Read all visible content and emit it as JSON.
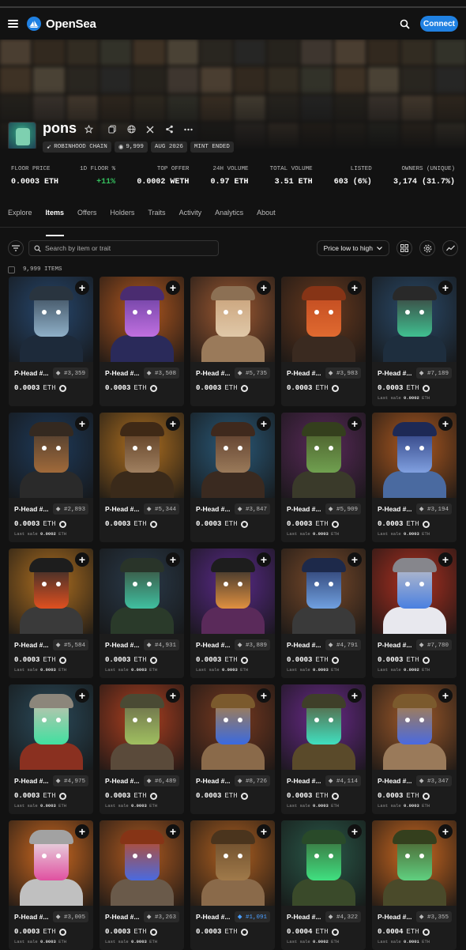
{
  "header": {
    "brand": "OpenSea",
    "connect_label": "Connect"
  },
  "collection": {
    "name": "pons",
    "chips": [
      {
        "icon": "robinhood-icon",
        "label": "ROBINHOOD CHAIN"
      },
      {
        "icon": "items-icon",
        "label": "9,999"
      },
      {
        "icon": "",
        "label": "AUG 2026"
      },
      {
        "icon": "",
        "label": "MINT ENDED"
      }
    ]
  },
  "stats": [
    {
      "label": "FLOOR PRICE",
      "value": "0.0003 ETH"
    },
    {
      "label": "1D FLOOR %",
      "value": "+11%"
    },
    {
      "label": "TOP OFFER",
      "value": "0.0002 WETH"
    },
    {
      "label": "24H VOLUME",
      "value": "0.97 ETH"
    },
    {
      "label": "TOTAL VOLUME",
      "value": "3.51 ETH"
    },
    {
      "label": "LISTED",
      "value": "603 (6%)"
    },
    {
      "label": "OWNERS (UNIQUE)",
      "value": "3,174 (31.7%)"
    }
  ],
  "tabs": [
    "Explore",
    "Items",
    "Offers",
    "Holders",
    "Traits",
    "Activity",
    "Analytics",
    "About"
  ],
  "active_tab": "Items",
  "toolbar": {
    "search_placeholder": "Search by item or trait",
    "sort_label": "Price low to high"
  },
  "item_count": "9,999 ITEMS",
  "items": [
    {
      "name": "P-Head #...",
      "rank": "#3,359",
      "price": "0.0003",
      "unit": "ETH",
      "last_sale": "",
      "palette": [
        "#26476e",
        "#3a4a5a",
        "#1d2a3a",
        "#8fb0c8"
      ]
    },
    {
      "name": "P-Head #...",
      "rank": "#3,508",
      "price": "0.0003",
      "unit": "ETH",
      "last_sale": "",
      "palette": [
        "#b4581f",
        "#6a3fa0",
        "#2a2a5a",
        "#c070e0"
      ]
    },
    {
      "name": "P-Head #...",
      "rank": "#5,735",
      "price": "0.0003",
      "unit": "ETH",
      "last_sale": "",
      "palette": [
        "#a05a32",
        "#c8a078",
        "#9a7a5a",
        "#e0c8a8"
      ]
    },
    {
      "name": "P-Head #...",
      "rank": "#3,983",
      "price": "0.0003",
      "unit": "ETH",
      "last_sale": "",
      "palette": [
        "#6a3a1e",
        "#c04a20",
        "#3a2a20",
        "#e06a30"
      ]
    },
    {
      "name": "P-Head #...",
      "rank": "#7,189",
      "price": "0.0003",
      "unit": "ETH",
      "last_sale": "0.0002",
      "palette": [
        "#2a4a6a",
        "#3a3a3a",
        "#1e2e3e",
        "#40c090"
      ]
    },
    {
      "name": "P-Head #...",
      "rank": "#2,893",
      "price": "0.0003",
      "unit": "ETH",
      "last_sale": "0.0002",
      "palette": [
        "#1e3a5a",
        "#4a3a2e",
        "#2a2a2a",
        "#a06a3a"
      ]
    },
    {
      "name": "P-Head #...",
      "rank": "#5,344",
      "price": "0.0003",
      "unit": "ETH",
      "last_sale": "",
      "palette": [
        "#b07020",
        "#5a3a20",
        "#3a2a1a",
        "#a08060"
      ]
    },
    {
      "name": "P-Head #...",
      "rank": "#3,847",
      "price": "0.0003",
      "unit": "ETH",
      "last_sale": "",
      "palette": [
        "#2a5a7a",
        "#5a3a2a",
        "#3a2a20",
        "#9a7a5a"
      ]
    },
    {
      "name": "P-Head #...",
      "rank": "#5,909",
      "price": "0.0003",
      "unit": "ETH",
      "last_sale": "0.0003",
      "palette": [
        "#5a2a5a",
        "#4a5a2a",
        "#3a3a2a",
        "#70a050"
      ]
    },
    {
      "name": "P-Head #...",
      "rank": "#3,194",
      "price": "0.0003",
      "unit": "ETH",
      "last_sale": "0.0003",
      "palette": [
        "#b05a20",
        "#2a3a7a",
        "#4a6aa0",
        "#80a0e0"
      ]
    },
    {
      "name": "P-Head #...",
      "rank": "#5,584",
      "price": "0.0003",
      "unit": "ETH",
      "last_sale": "0.0003",
      "palette": [
        "#b07020",
        "#2a2a2a",
        "#3a3a3a",
        "#e05020"
      ]
    },
    {
      "name": "P-Head #...",
      "rank": "#4,931",
      "price": "0.0003",
      "unit": "ETH",
      "last_sale": "0.0003",
      "palette": [
        "#2a3a4a",
        "#3a4a3a",
        "#2a3a2a",
        "#40c0a0"
      ]
    },
    {
      "name": "P-Head #...",
      "rank": "#3,889",
      "price": "0.0003",
      "unit": "ETH",
      "last_sale": "0.0003",
      "palette": [
        "#5a2a8a",
        "#2a2a2a",
        "#5a2a5a",
        "#e09040"
      ]
    },
    {
      "name": "P-Head #...",
      "rank": "#4,791",
      "price": "0.0003",
      "unit": "ETH",
      "last_sale": "0.0003",
      "palette": [
        "#7a4a2a",
        "#2a3a6a",
        "#3a3a3a",
        "#70a0e0"
      ]
    },
    {
      "name": "P-Head #...",
      "rank": "#7,780",
      "price": "0.0003",
      "unit": "ETH",
      "last_sale": "0.0002",
      "palette": [
        "#b03020",
        "#c0c0c8",
        "#e8e8ee",
        "#4a80e0"
      ]
    },
    {
      "name": "P-Head #...",
      "rank": "#4,975",
      "price": "0.0003",
      "unit": "ETH",
      "last_sale": "0.0003",
      "palette": [
        "#2a4a5a",
        "#c8c0b0",
        "#8a3020",
        "#40e0a0"
      ]
    },
    {
      "name": "P-Head #...",
      "rank": "#6,489",
      "price": "0.0003",
      "unit": "ETH",
      "last_sale": "0.0003",
      "palette": [
        "#b04020",
        "#6a6a4a",
        "#5a4a3a",
        "#a0c060"
      ]
    },
    {
      "name": "P-Head #...",
      "rank": "#8,726",
      "price": "0.0003",
      "unit": "ETH",
      "last_sale": "",
      "palette": [
        "#7a3a20",
        "#b08040",
        "#8a6a4a",
        "#3a6ae0"
      ]
    },
    {
      "name": "P-Head #...",
      "rank": "#4,114",
      "price": "0.0003",
      "unit": "ETH",
      "last_sale": "0.0003",
      "palette": [
        "#6a2a8a",
        "#5a5a3a",
        "#5a4a2a",
        "#40e0c0"
      ]
    },
    {
      "name": "P-Head #...",
      "rank": "#3,347",
      "price": "0.0003",
      "unit": "ETH",
      "last_sale": "0.0003",
      "palette": [
        "#a05a2a",
        "#b08040",
        "#9a7a5a",
        "#4a6ae0"
      ]
    },
    {
      "name": "P-Head #...",
      "rank": "#3,005",
      "price": "0.0003",
      "unit": "ETH",
      "last_sale": "0.0003",
      "palette": [
        "#d06a20",
        "#e8e8e8",
        "#c0c0c0",
        "#e050a0"
      ]
    },
    {
      "name": "P-Head #...",
      "rank": "#3,263",
      "price": "0.0003",
      "unit": "ETH",
      "last_sale": "0.0003",
      "palette": [
        "#b05a20",
        "#c04a20",
        "#6a5a4a",
        "#4a6ae0"
      ]
    },
    {
      "name": "P-Head #...",
      "rank": "#1,091",
      "price": "0.0003",
      "unit": "ETH",
      "last_sale": "",
      "palette": [
        "#b06020",
        "#6a4a2a",
        "#8a6a4a",
        "#a07a4a"
      ],
      "rank_blue": true
    },
    {
      "name": "P-Head #...",
      "rank": "#4,322",
      "price": "0.0004",
      "unit": "ETH",
      "last_sale": "0.0002",
      "palette": [
        "#2a5a4a",
        "#3a6a3a",
        "#3a4a2a",
        "#40e080"
      ]
    },
    {
      "name": "P-Head #...",
      "rank": "#3,355",
      "price": "0.0004",
      "unit": "ETH",
      "last_sale": "0.0001",
      "palette": [
        "#d06a20",
        "#4a5a2a",
        "#4a4a2a",
        "#60d080"
      ]
    }
  ],
  "last_sale_prefix": "Last sale",
  "colors": {
    "accent": "#2081e2",
    "positive": "#35c25f",
    "background": "#121212",
    "card": "#1c1c1c"
  }
}
